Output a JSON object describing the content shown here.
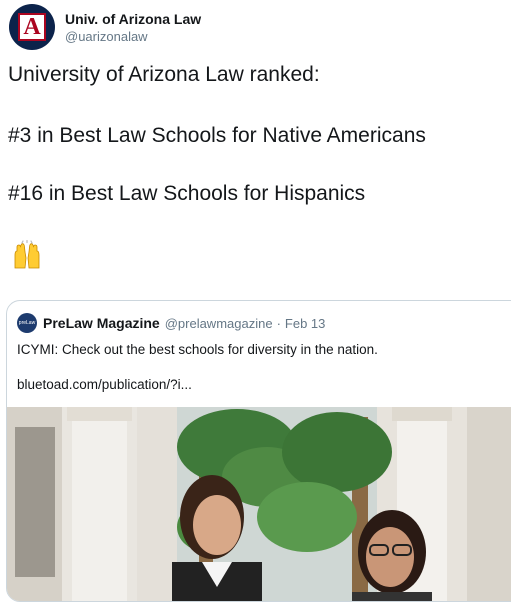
{
  "author": {
    "display_name": "Univ. of Arizona Law",
    "handle": "@uarizonalaw",
    "logo_letter": "A",
    "brand_colors": {
      "navy": "#0c234b",
      "red": "#ab0520"
    }
  },
  "tweet": {
    "line1": "University of Arizona Law ranked:",
    "line2": "#3 in Best Law Schools for Native Americans",
    "line3": "#16 in Best Law Schools for Hispanics",
    "emoji_icon": "raising-hands-icon"
  },
  "quoted": {
    "avatar_text": "preLaw",
    "display_name": "PreLaw Magazine",
    "handle": "@prelawmagazine",
    "separator": "·",
    "date": "Feb 13",
    "text": "ICYMI: Check out the best schools for diversity in the nation.",
    "link": "bluetoad.com/publication/?i..."
  }
}
